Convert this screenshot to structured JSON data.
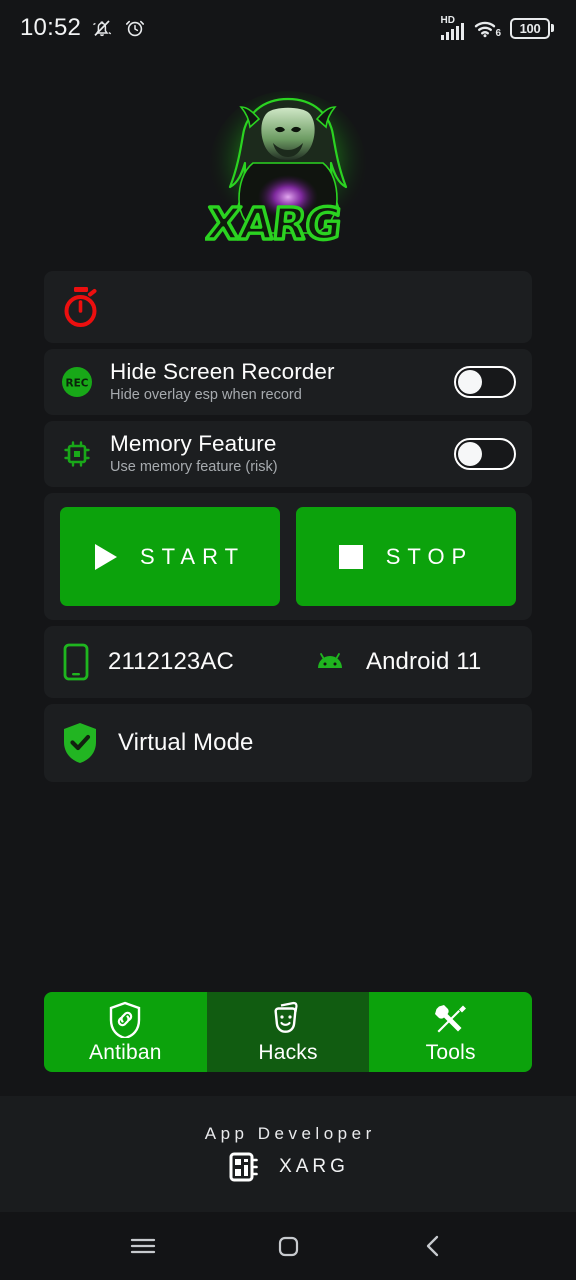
{
  "statusbar": {
    "time": "10:52",
    "icons_left": [
      "mute-bell-icon",
      "alarm-clock-icon"
    ],
    "network_label": "HD",
    "wifi_label": "6",
    "battery_level": "100"
  },
  "logo": {
    "brand_text": "XARG",
    "alt": "xarg-predator-logo",
    "glow_color": "#22c31e"
  },
  "timer_card": {
    "icon": "stopwatch-icon",
    "icon_color": "#ec0f0f"
  },
  "toggles": [
    {
      "icon": "rec-icon",
      "icon_label": "REC",
      "title": "Hide Screen Recorder",
      "subtitle": "Hide overlay esp when record",
      "state": "off"
    },
    {
      "icon": "memory-chip-icon",
      "title": "Memory Feature",
      "subtitle": "Use memory feature (risk)",
      "state": "off"
    }
  ],
  "actions": {
    "start_label": "START",
    "stop_label": "STOP",
    "button_color": "#0ca20c"
  },
  "device": {
    "model": "2112123AC",
    "model_icon": "phone-icon",
    "os": "Android 11",
    "os_icon": "android-icon"
  },
  "virtual_mode": {
    "label": "Virtual Mode",
    "icon": "shield-check-icon",
    "icon_color": "#22b522"
  },
  "tabs": [
    {
      "label": "Antiban",
      "icon": "shield-link-icon",
      "active": true
    },
    {
      "label": "Hacks",
      "icon": "theater-masks-icon",
      "active": false
    },
    {
      "label": "Tools",
      "icon": "wrench-screwdriver-icon",
      "active": true
    }
  ],
  "footer": {
    "title": "App Developer",
    "developer": "XARG",
    "icon": "chip-icon"
  },
  "navbar": {
    "recents": "menu-icon",
    "home": "home-square-icon",
    "back": "chevron-left-icon"
  }
}
